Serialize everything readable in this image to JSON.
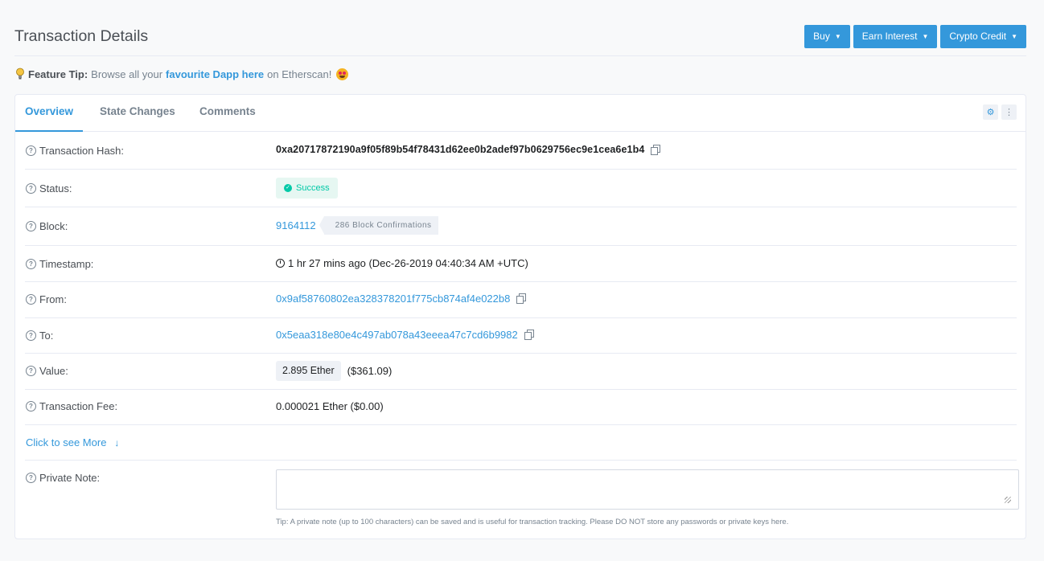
{
  "header": {
    "title": "Transaction Details",
    "buttons": [
      {
        "label": "Buy"
      },
      {
        "label": "Earn Interest"
      },
      {
        "label": "Crypto Credit"
      }
    ]
  },
  "feature_tip": {
    "prefix": "Feature Tip:",
    "text_before": "Browse all your",
    "link": "favourite Dapp here",
    "text_after": "on Etherscan!"
  },
  "tabs": [
    {
      "label": "Overview",
      "active": true
    },
    {
      "label": "State Changes",
      "active": false
    },
    {
      "label": "Comments",
      "active": false
    }
  ],
  "details": {
    "hash": {
      "label": "Transaction Hash:",
      "value": "0xa20717872190a9f05f89b54f78431d62ee0b2adef97b0629756ec9e1cea6e1b4"
    },
    "status": {
      "label": "Status:",
      "value": "Success",
      "color": "#00c9a7"
    },
    "block": {
      "label": "Block:",
      "value": "9164112",
      "confirmations": "286 Block Confirmations"
    },
    "timestamp": {
      "label": "Timestamp:",
      "value": "1 hr 27 mins ago (Dec-26-2019 04:40:34 AM +UTC)"
    },
    "from": {
      "label": "From:",
      "value": "0x9af58760802ea328378201f775cb874af4e022b8"
    },
    "to": {
      "label": "To:",
      "value": "0x5eaa318e80e4c497ab078a43eeea47c7cd6b9982"
    },
    "value": {
      "label": "Value:",
      "ether": "2.895 Ether",
      "usd": "($361.09)"
    },
    "fee": {
      "label": "Transaction Fee:",
      "value": "0.000021 Ether ($0.00)"
    },
    "more": {
      "label": "Click to see More"
    },
    "note": {
      "label": "Private Note:",
      "tip": "Tip: A private note (up to 100 characters) can be saved and is useful for transaction tracking. Please DO NOT store any passwords or private keys here."
    }
  },
  "colors": {
    "accent": "#3498db",
    "success": "#00c9a7",
    "text": "#1e2022",
    "muted": "#77838f"
  }
}
